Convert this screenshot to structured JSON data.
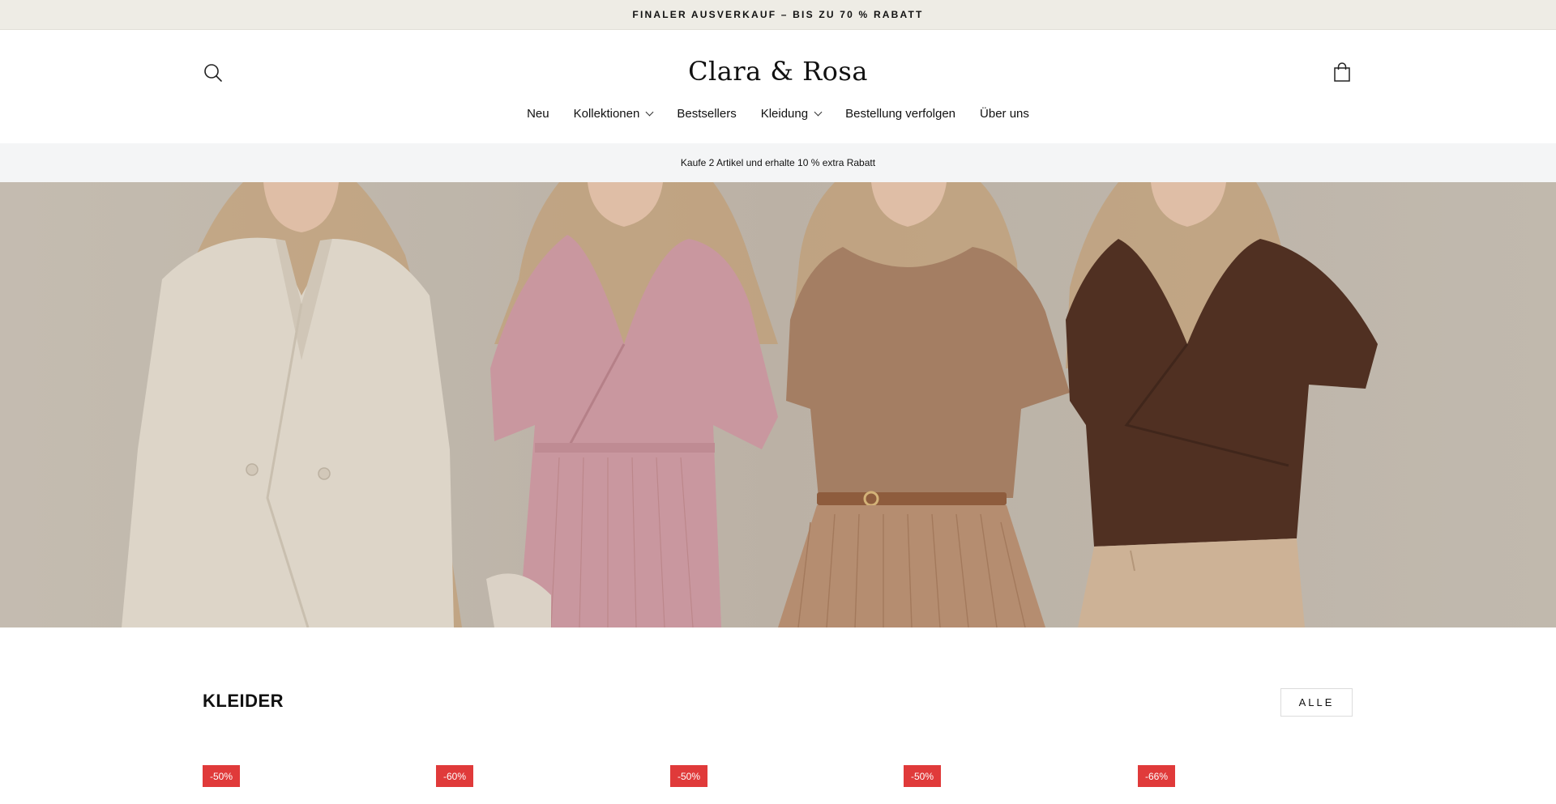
{
  "announcement": {
    "text": "FINALER AUSVERKAUF – BIS ZU 70 % RABATT"
  },
  "header": {
    "logo": "Clara & Rosa",
    "icons": {
      "search": "search-icon",
      "cart": "shopping-bag-icon"
    }
  },
  "nav": {
    "items": [
      {
        "label": "Neu",
        "has_dropdown": false
      },
      {
        "label": "Kollektionen",
        "has_dropdown": true
      },
      {
        "label": "Bestsellers",
        "has_dropdown": false
      },
      {
        "label": "Kleidung",
        "has_dropdown": true
      },
      {
        "label": "Bestellung verfolgen",
        "has_dropdown": false
      },
      {
        "label": "Über uns",
        "has_dropdown": false
      }
    ]
  },
  "promo": {
    "text": "Kaufe 2 Artikel und erhalte 10 % extra Rabatt"
  },
  "hero": {
    "outfits": [
      "cream-blazer",
      "pink-wrap-dress",
      "camel-top-pleated-skirt",
      "brown-wrap-blouse"
    ],
    "colors": {
      "background": "#c4bcb2",
      "cream": "#e4ddd1",
      "pink": "#cf9aa4",
      "camel": "#a67e63",
      "brown": "#4b2a1d"
    }
  },
  "section": {
    "title": "KLEIDER",
    "all_button": "ALLE"
  },
  "products": {
    "badges": [
      "-50%",
      "-60%",
      "-50%",
      "-50%",
      "-66%"
    ]
  },
  "colors": {
    "announcement_bg": "#eeece5",
    "promo_bg": "#f4f5f6",
    "badge": "#e03a3a"
  }
}
